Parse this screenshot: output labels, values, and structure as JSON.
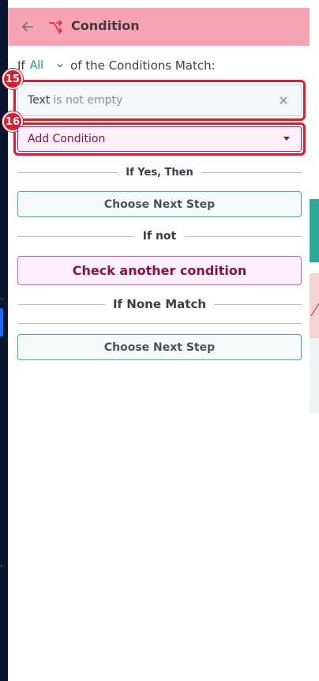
{
  "header": {
    "title": "Condition"
  },
  "match": {
    "prefix": "If",
    "selected": "All",
    "suffix": "of the Conditions Match:"
  },
  "condition": {
    "field": "Text",
    "operator": "is not empty"
  },
  "add_condition": {
    "label": "Add Condition"
  },
  "yes_section": {
    "label": "If Yes, Then",
    "button": "Choose Next Step"
  },
  "not_section": {
    "label": "If not",
    "button": "Check another condition"
  },
  "none_section": {
    "label": "If None Match",
    "button": "Choose Next Step"
  },
  "badges": {
    "condition_row": "15",
    "add_condition": "16"
  },
  "colors": {
    "header_bg": "#f6a3b3",
    "accent_teal": "#1f8f80",
    "highlight_red": "#e3192a",
    "magenta": "#8a1044"
  }
}
